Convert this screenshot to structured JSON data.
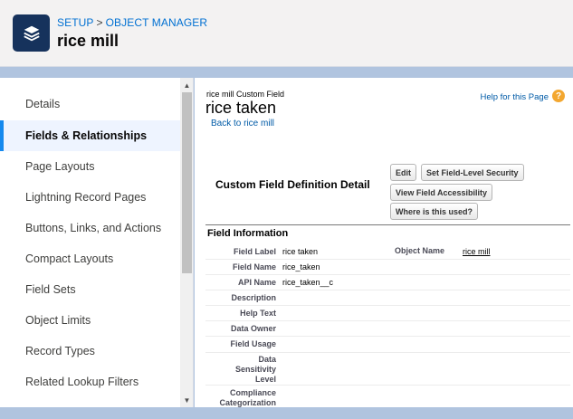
{
  "header": {
    "breadcrumb_setup": "SETUP",
    "breadcrumb_sep": ">",
    "breadcrumb_object_manager": "OBJECT MANAGER",
    "title": "rice mill",
    "icon": "layers-icon",
    "icon_bg": "#16325c"
  },
  "sidebar": {
    "items": [
      {
        "label": "Details",
        "active": false
      },
      {
        "label": "Fields & Relationships",
        "active": true
      },
      {
        "label": "Page Layouts",
        "active": false
      },
      {
        "label": "Lightning Record Pages",
        "active": false
      },
      {
        "label": "Buttons, Links, and Actions",
        "active": false
      },
      {
        "label": "Compact Layouts",
        "active": false
      },
      {
        "label": "Field Sets",
        "active": false
      },
      {
        "label": "Object Limits",
        "active": false
      },
      {
        "label": "Record Types",
        "active": false
      },
      {
        "label": "Related Lookup Filters",
        "active": false
      }
    ],
    "active_accent": "#1589ee"
  },
  "main": {
    "subtitle": "rice mill Custom Field",
    "title": "rice taken",
    "back_link": "Back to rice mill",
    "help_link": "Help for this Page",
    "help_icon": "?",
    "definition_title": "Custom Field Definition Detail",
    "buttons": {
      "edit": "Edit",
      "set_fls": "Set Field-Level Security",
      "view_access": "View Field Accessibility",
      "where_used": "Where is this used?"
    },
    "section_title": "Field Information",
    "fields": [
      {
        "label": "Field Label",
        "value": "rice taken"
      },
      {
        "label": "Field Name",
        "value": "rice_taken"
      },
      {
        "label": "API Name",
        "value": "rice_taken__c"
      },
      {
        "label": "Description",
        "value": ""
      },
      {
        "label": "Help Text",
        "value": ""
      },
      {
        "label": "Data Owner",
        "value": ""
      },
      {
        "label": "Field Usage",
        "value": ""
      },
      {
        "label": "Data Sensitivity Level",
        "value": ""
      },
      {
        "label": "Compliance Categorization",
        "value": ""
      }
    ],
    "object_name_label": "Object Name",
    "object_name_value": "rice mill"
  }
}
